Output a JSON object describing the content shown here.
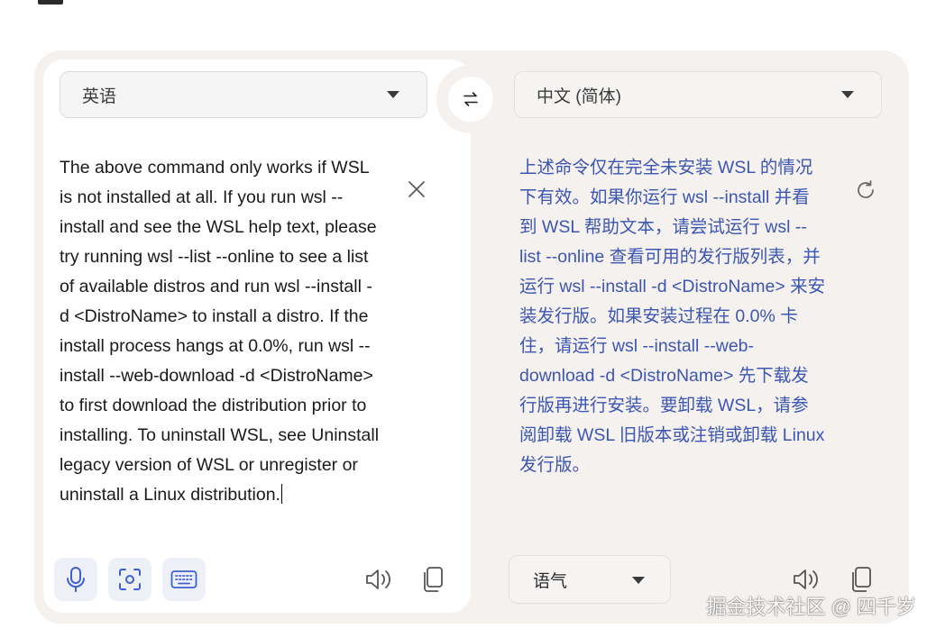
{
  "source": {
    "language": "英语",
    "text": "The above command only works if WSL\nis not installed at all. If you run wsl --\ninstall and see the WSL help text, please\ntry running wsl --list --online to see a list\nof available distros and run wsl --install -\nd <DistroName> to install a distro. If the\ninstall process hangs at 0.0%, run wsl --\ninstall --web-download -d <DistroName>\nto first download the distribution prior to\ninstalling. To uninstall WSL, see Uninstall\nlegacy version of WSL or unregister or\nuninstall a Linux distribution."
  },
  "target": {
    "language": "中文 (简体)",
    "text": "上述命令仅在完全未安装 WSL 的情况\n下有效。如果你运行 wsl --install 并看\n到 WSL 帮助文本，请尝试运行 wsl --\nlist --online 查看可用的发行版列表，并\n运行 wsl --install -d <DistroName> 来安\n装发行版。如果安装过程在 0.0% 卡\n住，请运行 wsl --install --web-\ndownload -d <DistroName> 先下载发\n行版再进行安装。要卸载 WSL，请参\n阅卸载 WSL 旧版本或注销或卸载 Linux\n发行版。",
    "tone_label": "语气"
  },
  "watermark": "掘金技术社区 @ 四千岁",
  "icons": {
    "swap": "swap-arrows-icon",
    "clear": "close-icon",
    "refresh": "refresh-icon",
    "mic": "microphone-icon",
    "camera": "camera-scan-icon",
    "keyboard": "keyboard-icon",
    "speaker": "speaker-icon",
    "copy": "copy-icon"
  },
  "colors": {
    "translation_text": "#3d56b2",
    "tool_icon": "#3f5fd1",
    "panel_background": "#f4f1ee"
  }
}
